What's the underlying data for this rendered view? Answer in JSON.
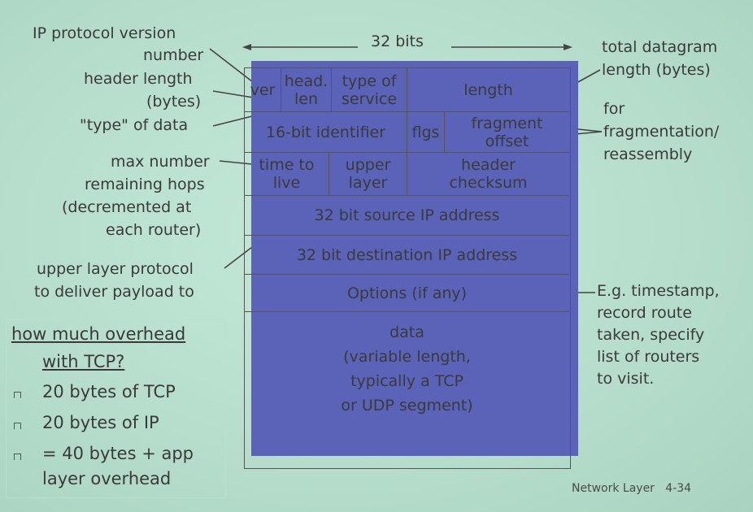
{
  "bits_label": "32 bits",
  "left_labels": {
    "ip_version": [
      "IP protocol version",
      "number"
    ],
    "header_length": [
      "header length",
      "(bytes)"
    ],
    "type_of_data": "\"type\" of data",
    "max_hops": [
      "max number",
      "remaining hops",
      "(decremented at",
      "each router)"
    ],
    "upper_layer": [
      "upper layer protocol",
      "to deliver payload to"
    ]
  },
  "right_labels": {
    "total_length": [
      "total datagram",
      "length (bytes)"
    ],
    "fragmentation": [
      "for",
      "fragmentation/",
      "reassembly"
    ],
    "options_note": [
      "E.g. timestamp,",
      "record route",
      "taken, specify",
      "list of routers",
      "to visit."
    ]
  },
  "fields": {
    "ver": "ver",
    "head_len": [
      "head.",
      "len"
    ],
    "type_of_service": [
      "type of",
      "service"
    ],
    "length": "length",
    "identifier": "16-bit identifier",
    "flags": "flgs",
    "fragment_offset": [
      "fragment",
      "offset"
    ],
    "ttl": [
      "time to",
      "live"
    ],
    "upper_layer": [
      "upper",
      "layer"
    ],
    "checksum": [
      "header",
      "checksum"
    ],
    "src": "32 bit source IP address",
    "dst": "32 bit destination IP address",
    "options": "Options (if any)",
    "data": [
      "data",
      "(variable length,",
      "typically a TCP",
      "or UDP segment)"
    ]
  },
  "overhead": {
    "question": [
      "how much overhead",
      "with TCP?"
    ],
    "items": [
      "20 bytes of TCP",
      "20 bytes of IP",
      "= 40 bytes + app",
      "layer overhead"
    ]
  },
  "footer": "Network Layer   4-34"
}
